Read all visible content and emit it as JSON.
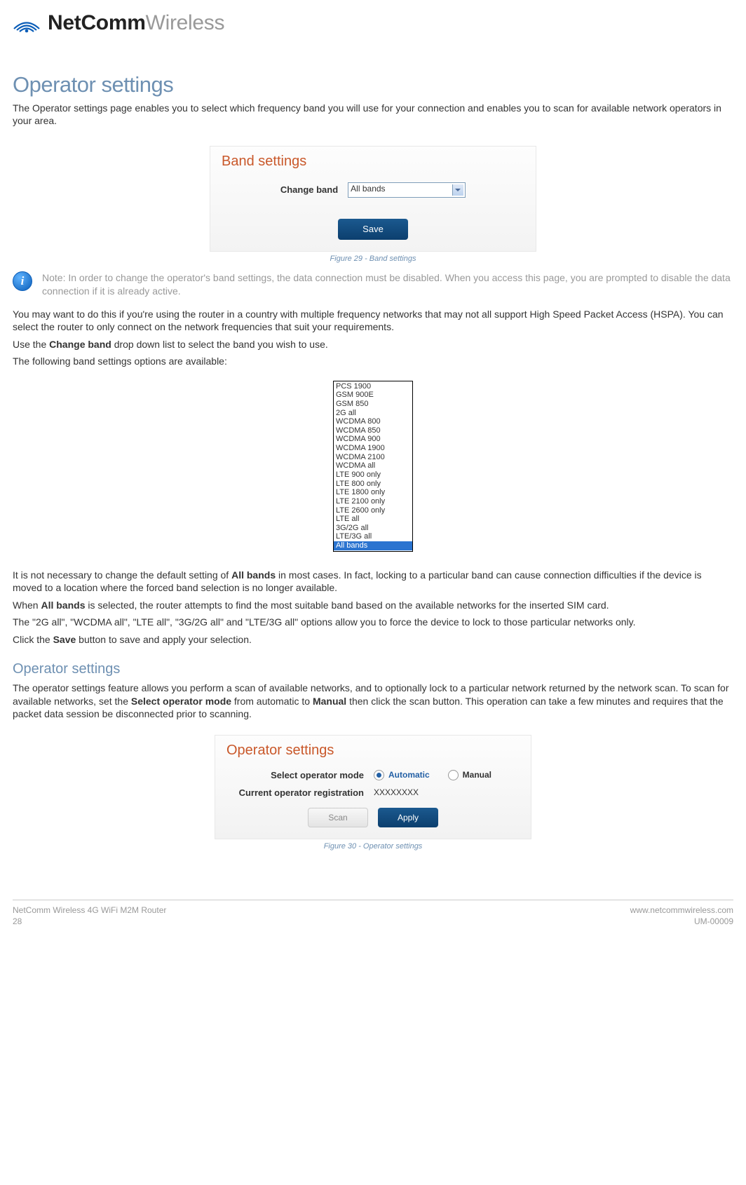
{
  "brand": {
    "bold": "NetComm",
    "light": "Wireless"
  },
  "h1": "Operator settings",
  "intro": "The Operator settings page enables you to select which frequency band you will use for your connection and enables you to scan for available network operators in your area.",
  "bandPanel": {
    "title": "Band settings",
    "label": "Change band",
    "value": "All bands",
    "saveLabel": "Save"
  },
  "fig29": "Figure 29 - Band settings",
  "noteGlyph": "i",
  "note": "Note: In order to change the operator's band settings, the data connection must be disabled. When you access this page, you are prompted to disable the data connection if it is already active.",
  "p_hspa": "You may want to do this if you're using the router in a country with multiple frequency networks that may not all support High Speed Packet Access (HSPA). You can select the router to only connect on the network frequencies that suit your requirements.",
  "p_use_pre": "Use the ",
  "p_use_bold": "Change band",
  "p_use_post": " drop down list to select the band you wish to use.",
  "p_following": "The following band settings options are available:",
  "bandOptions": [
    "PCS 1900",
    "GSM 900E",
    "GSM 850",
    "2G all",
    "WCDMA 800",
    "WCDMA 850",
    "WCDMA 900",
    "WCDMA 1900",
    "WCDMA 2100",
    "WCDMA all",
    "LTE 900 only",
    "LTE 800 only",
    "LTE 1800 only",
    "LTE 2100 only",
    "LTE 2600 only",
    "LTE all",
    "3G/2G all",
    "LTE/3G all",
    "All bands"
  ],
  "p_notnec_pre": "It is not necessary to change the default setting of ",
  "p_notnec_bold": "All bands",
  "p_notnec_post": " in most cases. In fact, locking to a particular band can cause connection difficulties if the device is moved to a location where the forced band selection is no longer available.",
  "p_whenall_pre": "When ",
  "p_whenall_bold": "All bands",
  "p_whenall_post": " is selected, the router attempts to find the most suitable band based on the available networks for the inserted SIM card.",
  "p_modes": "The \"2G all\", \"WCDMA all\", \"LTE all\", \"3G/2G all\" and \"LTE/3G all\" options allow you to force the device to lock to those particular networks only.",
  "p_click_pre": "Click the ",
  "p_click_bold": "Save",
  "p_click_post": " button to save and apply your selection.",
  "h2": "Operator settings",
  "p_opintro_a": "The operator settings feature allows you perform a scan of available networks, and to optionally lock to a particular network returned by the network scan. To scan for available networks, set the ",
  "p_opintro_b1": "Select operator mode",
  "p_opintro_c": " from automatic to ",
  "p_opintro_b2": "Manual",
  "p_opintro_d": " then click the scan button. This operation can take a few minutes and requires that the packet data session be disconnected prior to scanning.",
  "opPanel": {
    "title": "Operator settings",
    "modeLabel": "Select operator mode",
    "autoLabel": "Automatic",
    "manualLabel": "Manual",
    "regLabel": "Current operator registration",
    "regValue": "XXXXXXXX",
    "scanLabel": "Scan",
    "applyLabel": "Apply"
  },
  "fig30": "Figure 30 - Operator settings",
  "footer": {
    "leftTop": "NetComm Wireless 4G WiFi M2M Router",
    "leftBottom": "28",
    "rightTop": "www.netcommwireless.com",
    "rightBottom": "UM-00009"
  }
}
